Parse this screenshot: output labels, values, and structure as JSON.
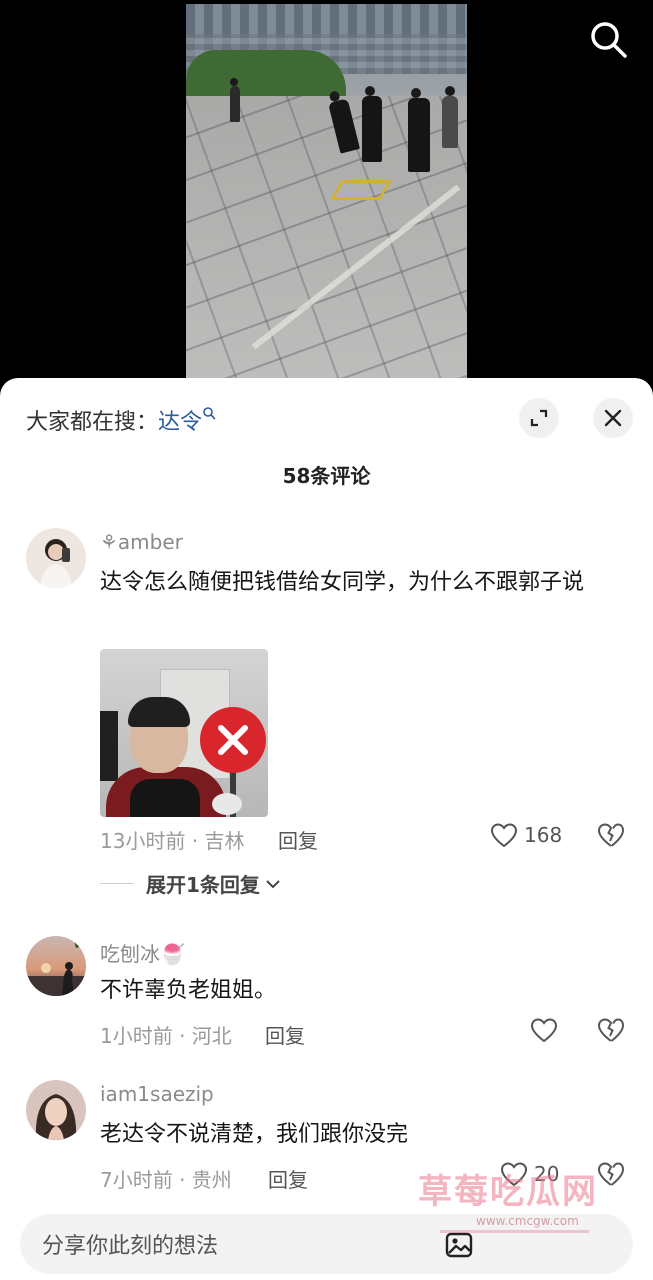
{
  "video": {
    "search_icon": "search-icon"
  },
  "comments_panel": {
    "hot_search_prefix": "大家都在搜：",
    "hot_search_term": "达令",
    "comment_count": "58条评论",
    "expand_icon": "expand-icon",
    "close_icon": "close-icon"
  },
  "comments": [
    {
      "username": "⚘amber",
      "text": "达令怎么随便把钱借给女同学，为什么不跟郭子说",
      "time_location": "13小时前 · 吉林",
      "reply_label": "回复",
      "like_count": "168",
      "expand_replies": "展开1条回复",
      "has_image": true
    },
    {
      "username": "吃刨冰🍧",
      "text": "不许辜负老姐姐。",
      "time_location": "1小时前 · 河北",
      "reply_label": "回复",
      "like_count": ""
    },
    {
      "username": "iam1saezip",
      "text": "老达令不说清楚，我们跟你没完",
      "time_location": "7小时前 · 贵州",
      "reply_label": "回复",
      "like_count": "20"
    }
  ],
  "input_bar": {
    "placeholder": "分享你此刻的想法",
    "image_icon": "image-icon"
  },
  "watermark": {
    "title": "草莓吃瓜网",
    "url": "www.cmcgw.com"
  },
  "colors": {
    "link": "#2b5c9e",
    "background": "#000000",
    "sheet": "#ffffff"
  }
}
